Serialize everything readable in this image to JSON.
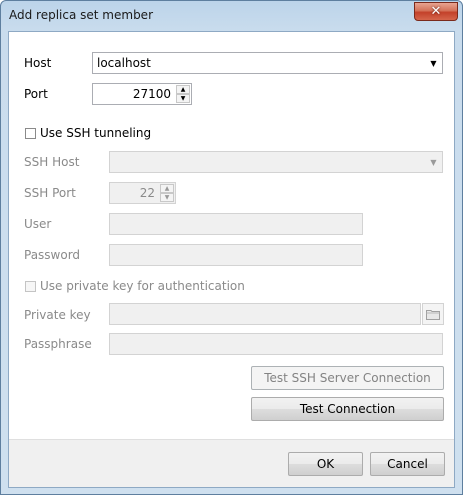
{
  "window": {
    "title": "Add replica set member",
    "close_label": "✕"
  },
  "form": {
    "host": {
      "label": "Host",
      "value": "localhost"
    },
    "port": {
      "label": "Port",
      "value": "27100"
    },
    "ssh_tunneling": {
      "label": "Use SSH tunneling",
      "checked": false
    },
    "ssh_host": {
      "label": "SSH Host",
      "value": ""
    },
    "ssh_port": {
      "label": "SSH Port",
      "value": "22"
    },
    "user": {
      "label": "User",
      "value": ""
    },
    "password": {
      "label": "Password",
      "value": ""
    },
    "private_key_auth": {
      "label": "Use private key for authentication",
      "checked": false
    },
    "private_key": {
      "label": "Private key",
      "value": ""
    },
    "passphrase": {
      "label": "Passphrase",
      "value": ""
    }
  },
  "buttons": {
    "test_ssh": "Test SSH Server Connection",
    "test_connection": "Test Connection",
    "ok": "OK",
    "cancel": "Cancel"
  },
  "icons": {
    "dropdown": "chevron-down-icon",
    "spin": "spin-arrows-icon",
    "browse": "folder-icon"
  }
}
